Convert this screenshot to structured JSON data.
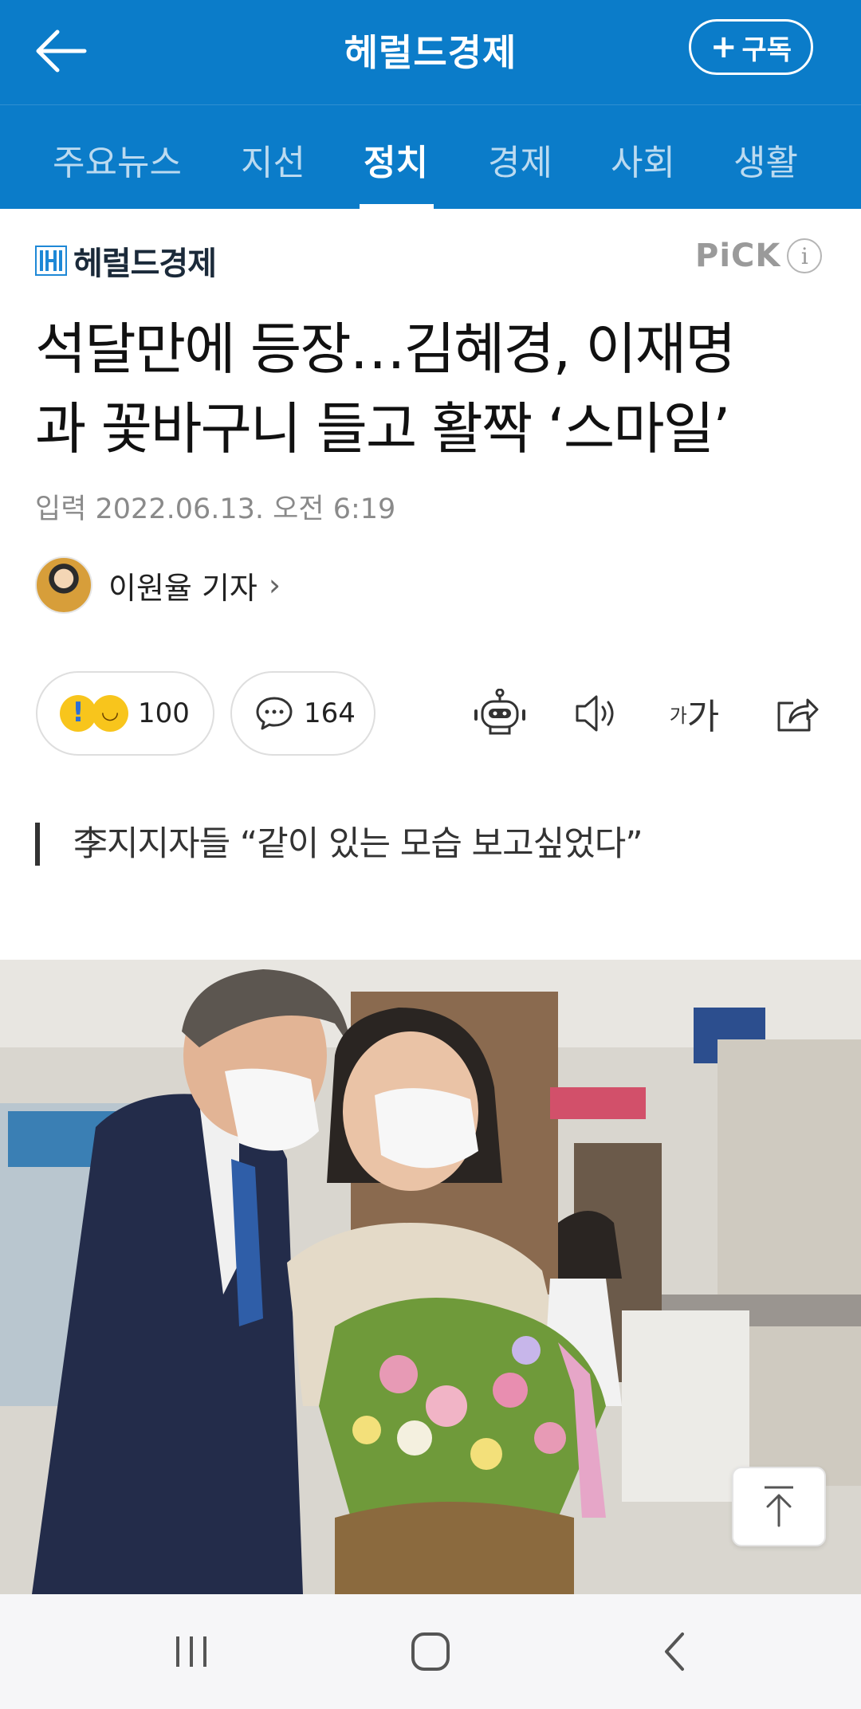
{
  "topbar": {
    "title": "헤럴드경제",
    "subscribe_label": "구독",
    "subscribe_plus": "+"
  },
  "tabs": [
    {
      "label": "주요뉴스",
      "active": false
    },
    {
      "label": "지선",
      "active": false
    },
    {
      "label": "정치",
      "active": true
    },
    {
      "label": "경제",
      "active": false
    },
    {
      "label": "사회",
      "active": false
    },
    {
      "label": "생활",
      "active": false
    }
  ],
  "press": {
    "name": "헤럴드경제",
    "pick_label": "PiCK",
    "info_glyph": "i"
  },
  "article": {
    "headline_line1": "석달만에 등장…김혜경, 이재명",
    "headline_line2": "과 꽃바구니 들고 활짝 ‘스마일’",
    "dateline": "입력 2022.06.13. 오전 6:19",
    "reporter": "이원율 기자",
    "reporter_chevron": "›",
    "summary": "李지지자들 “같이 있는 모습 보고싶었다”"
  },
  "actions": {
    "reaction_count": "100",
    "comment_count": "164",
    "font_small": "가",
    "font_big": "가"
  },
  "colors": {
    "brand_blue": "#0b7cc9",
    "navbar_bg": "#f6f6f8"
  },
  "icons": [
    "back-arrow-icon",
    "robot-summary-icon",
    "speaker-icon",
    "share-icon",
    "comment-bubble-icon",
    "scroll-top-icon",
    "recent-apps-icon",
    "home-icon",
    "back-icon"
  ]
}
